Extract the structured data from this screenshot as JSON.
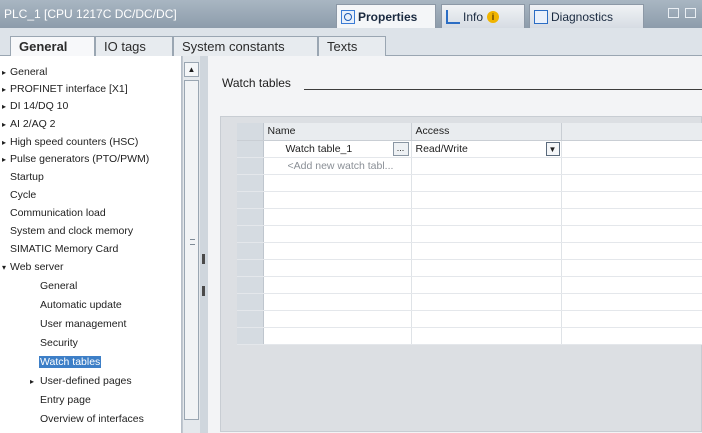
{
  "title": "PLC_1 [CPU 1217C DC/DC/DC]",
  "inspector_tabs": [
    {
      "label": "Properties",
      "icon": "properties-icon",
      "active": true
    },
    {
      "label": "Info",
      "icon": "info-icon",
      "active": false
    },
    {
      "label": "Diagnostics",
      "icon": "diagnostics-icon",
      "active": false
    }
  ],
  "info_badge": "i",
  "subtabs": [
    {
      "label": "General",
      "active": true
    },
    {
      "label": "IO tags",
      "active": false
    },
    {
      "label": "System constants",
      "active": false
    },
    {
      "label": "Texts",
      "active": false
    }
  ],
  "nav": [
    {
      "label": "General",
      "arrow": "▸",
      "indent": 0
    },
    {
      "label": "PROFINET interface [X1]",
      "arrow": "▸",
      "indent": 0
    },
    {
      "label": "DI 14/DQ 10",
      "arrow": "▸",
      "indent": 0
    },
    {
      "label": "AI 2/AQ 2",
      "arrow": "▸",
      "indent": 0
    },
    {
      "label": "High speed counters (HSC)",
      "arrow": "▸",
      "indent": 0
    },
    {
      "label": "Pulse generators (PTO/PWM)",
      "arrow": "▸",
      "indent": 0
    },
    {
      "label": "Startup",
      "arrow": "",
      "indent": 0
    },
    {
      "label": "Cycle",
      "arrow": "",
      "indent": 0
    },
    {
      "label": "Communication load",
      "arrow": "",
      "indent": 0
    },
    {
      "label": "System and clock memory",
      "arrow": "",
      "indent": 0
    },
    {
      "label": "SIMATIC Memory Card",
      "arrow": "",
      "indent": 0
    },
    {
      "label": "Web server",
      "arrow": "▾",
      "indent": 0
    },
    {
      "label": "General",
      "arrow": "",
      "indent": 1
    },
    {
      "label": "Automatic update",
      "arrow": "",
      "indent": 1
    },
    {
      "label": "User management",
      "arrow": "",
      "indent": 1
    },
    {
      "label": "Security",
      "arrow": "",
      "indent": 1
    },
    {
      "label": "Watch tables",
      "arrow": "",
      "indent": 1,
      "selected": true
    },
    {
      "label": "User-defined pages",
      "arrow": "▸",
      "indent": 1
    },
    {
      "label": "Entry page",
      "arrow": "",
      "indent": 1
    },
    {
      "label": "Overview of interfaces",
      "arrow": "",
      "indent": 1
    }
  ],
  "section_title": "Watch tables",
  "table": {
    "headers": {
      "name": "Name",
      "access": "Access"
    },
    "rows": [
      {
        "name": "Watch table_1",
        "access": "Read/Write"
      }
    ],
    "add_new": "<Add new watch tabl...",
    "browse_label": "...",
    "dropdown_glyph": "▼"
  },
  "colors": {
    "accent": "#3d7fc7",
    "titlebar": "#98a6b4"
  }
}
